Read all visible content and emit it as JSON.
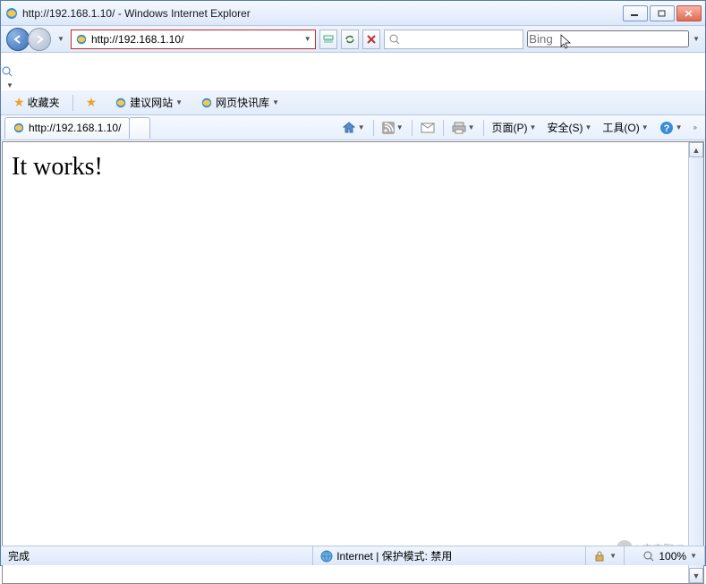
{
  "title": "http://192.168.1.10/ - Windows Internet Explorer",
  "nav": {
    "url": "http://192.168.1.10/",
    "search_placeholder": "Bing"
  },
  "favorites": {
    "label": "收藏夹",
    "suggested": "建议网站",
    "slice": "网页快讯库"
  },
  "tab": {
    "label": "http://192.168.1.10/"
  },
  "commands": {
    "page": "页面(P)",
    "safety": "安全(S)",
    "tools": "工具(O)"
  },
  "page": {
    "body": "It works!"
  },
  "status": {
    "done": "完成",
    "zone": "Internet | 保护模式: 禁用",
    "zoom": "100%"
  },
  "watermark": "L宝宝聊IT"
}
